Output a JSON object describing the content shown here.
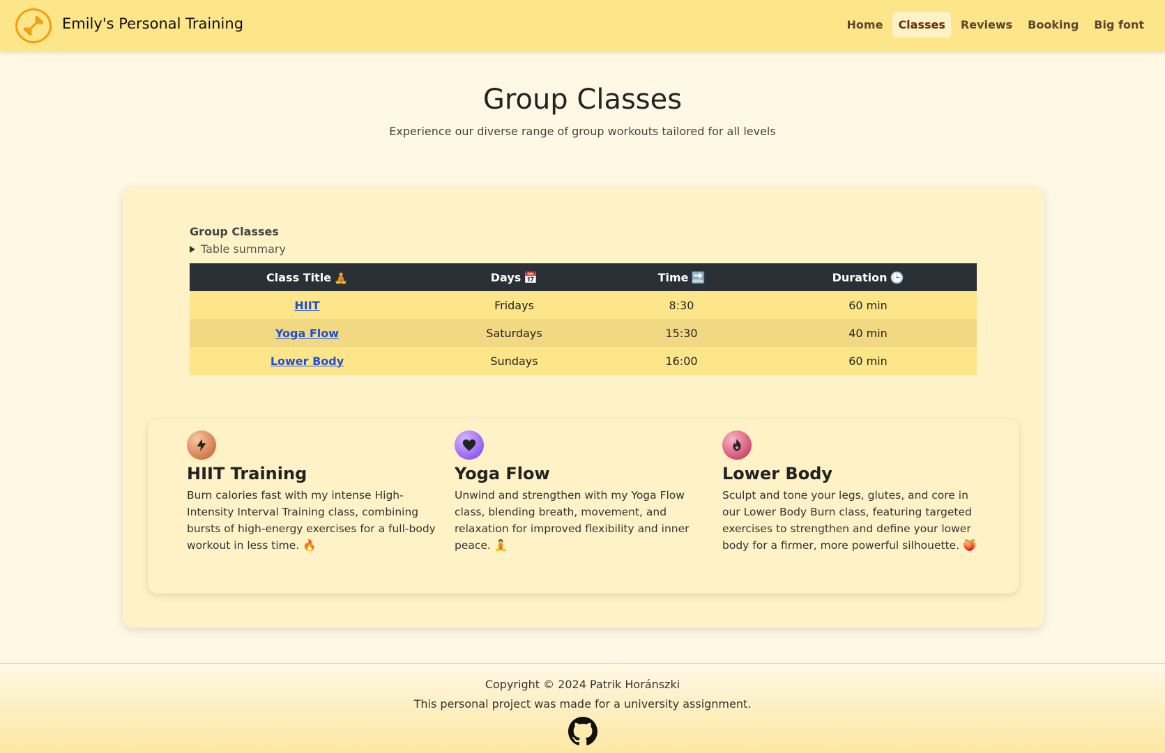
{
  "brand": {
    "name": "Emily's Personal Training",
    "logo_icon": "dumbbell-icon"
  },
  "nav": {
    "items": [
      {
        "label": "Home",
        "active": false
      },
      {
        "label": "Classes",
        "active": true
      },
      {
        "label": "Reviews",
        "active": false
      },
      {
        "label": "Booking",
        "active": false
      },
      {
        "label": "Big font",
        "active": false
      }
    ]
  },
  "hero": {
    "title": "Group Classes",
    "subtitle": "Experience our diverse range of group workouts tailored for all levels"
  },
  "table": {
    "caption": "Group Classes",
    "summary": "Table summary",
    "headers": [
      "Class Title",
      "Days",
      "Time",
      "Duration"
    ],
    "header_icons": [
      "🧘",
      "📅",
      "🔜",
      "🕒"
    ],
    "rows": [
      {
        "title": "HIIT",
        "days": "Fridays",
        "time": "8:30",
        "duration": "60 min"
      },
      {
        "title": "Yoga Flow",
        "days": "Saturdays",
        "time": "15:30",
        "duration": "40 min"
      },
      {
        "title": "Lower Body",
        "days": "Sundays",
        "time": "16:00",
        "duration": "60 min"
      }
    ]
  },
  "features": [
    {
      "icon": "lightning-icon",
      "title": "HIIT Training",
      "text": "Burn calories fast with my intense High-Intensity Interval Training class, combining bursts of high-energy exercises for a full-body workout in less time. 🔥"
    },
    {
      "icon": "heart-icon",
      "title": "Yoga Flow",
      "text": "Unwind and strengthen with my Yoga Flow class, blending breath, movement, and relaxation for improved flexibility and inner peace. 🧘"
    },
    {
      "icon": "fire-icon",
      "title": "Lower Body",
      "text": "Sculpt and tone your legs, glutes, and core in our Lower Body Burn class, featuring targeted exercises to strengthen and define your lower body for a firmer, more powerful silhouette. 🍑"
    }
  ],
  "footer": {
    "copyright": "Copyright © 2024 Patrik Horánszki",
    "note": "This personal project was made for a university assignment.",
    "icon": "github-icon"
  },
  "colors": {
    "navbar": "#fde68a",
    "accent": "#f59e0b",
    "table_header": "#2b2f36",
    "link": "#1d4ed8"
  }
}
